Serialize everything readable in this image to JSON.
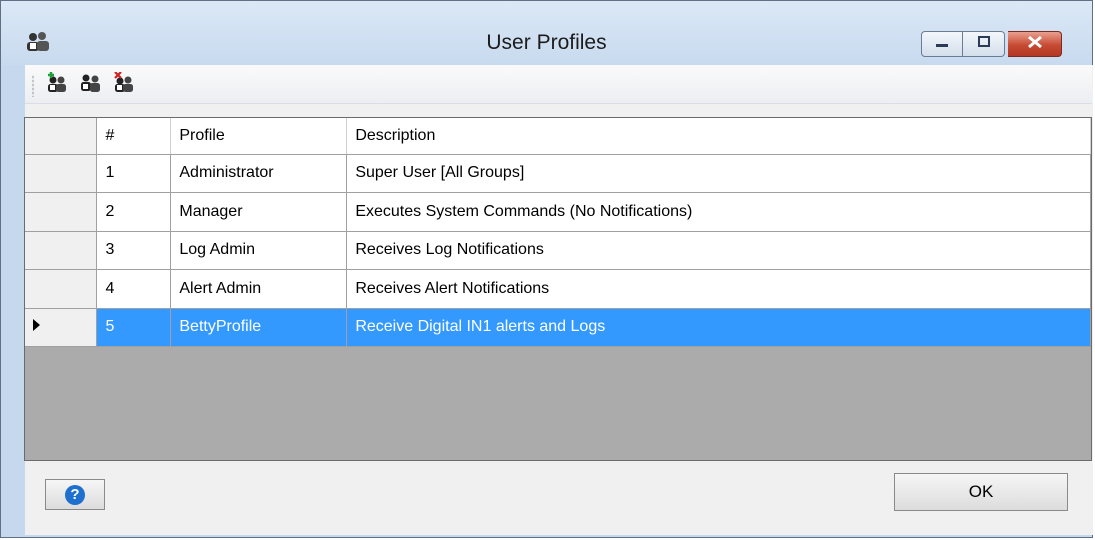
{
  "window": {
    "title": "User Profiles",
    "icon": "user-profiles-icon",
    "controls": [
      "minimize-icon",
      "maximize-icon",
      "close-icon"
    ]
  },
  "toolbar": {
    "items": [
      {
        "icon": "add-user-icon"
      },
      {
        "icon": "user-profile-icon"
      },
      {
        "icon": "delete-user-icon"
      }
    ]
  },
  "grid": {
    "columns": [
      "#",
      "Profile",
      "Description"
    ],
    "rows": [
      {
        "num": "1",
        "profile": "Administrator",
        "description": "Super User [All Groups]"
      },
      {
        "num": "2",
        "profile": "Manager",
        "description": "Executes System Commands (No Notifications)"
      },
      {
        "num": "3",
        "profile": "Log Admin",
        "description": "Receives Log Notifications"
      },
      {
        "num": "4",
        "profile": "Alert Admin",
        "description": "Receives Alert Notifications"
      },
      {
        "num": "5",
        "profile": "BettyProfile",
        "description": "Receive Digital IN1 alerts and Logs",
        "selected": true
      }
    ],
    "selection_color": "#3399ff"
  },
  "footer": {
    "help_label": "?",
    "ok_label": "OK"
  }
}
